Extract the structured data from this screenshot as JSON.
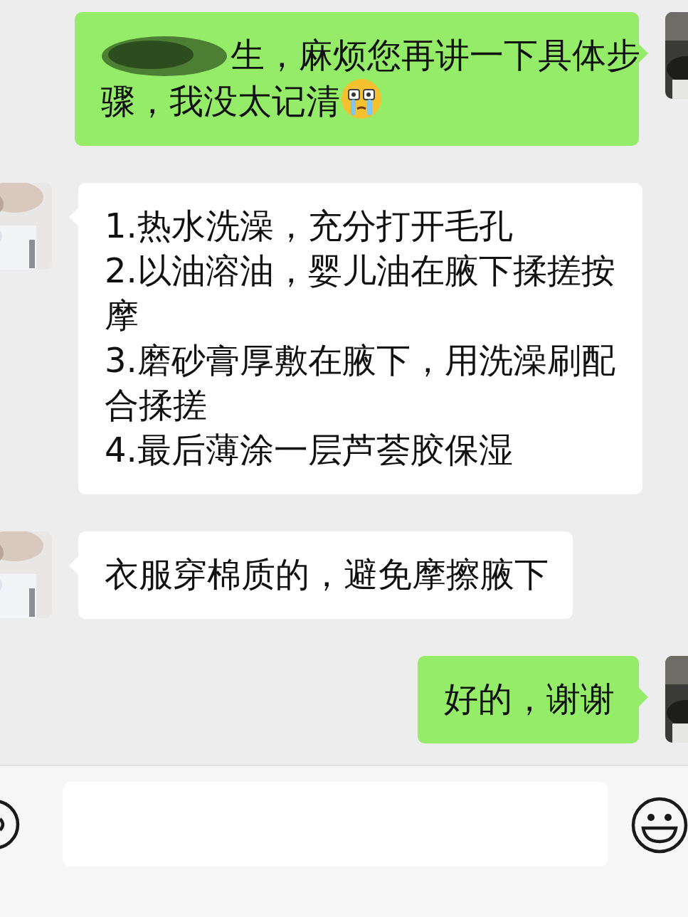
{
  "messages": [
    {
      "kind": "sent",
      "redacted": true,
      "has_emoji": true,
      "lines": [
        "生，麻烦您再讲一下具体步",
        "骤，我没太记清"
      ]
    },
    {
      "kind": "received",
      "redacted": false,
      "has_emoji": false,
      "lines": [
        "1.热水洗澡，充分打开毛孔",
        "2.以油溶油，婴儿油在腋下揉搓按摩",
        "3.磨砂膏厚敷在腋下，用洗澡刷配合揉搓",
        "4.最后薄涂一层芦荟胶保湿"
      ]
    },
    {
      "kind": "received",
      "redacted": false,
      "has_emoji": false,
      "lines": [
        "衣服穿棉质的，避免摩擦腋下"
      ]
    },
    {
      "kind": "sent",
      "redacted": false,
      "has_emoji": false,
      "lines": [
        "好的，谢谢"
      ]
    }
  ]
}
